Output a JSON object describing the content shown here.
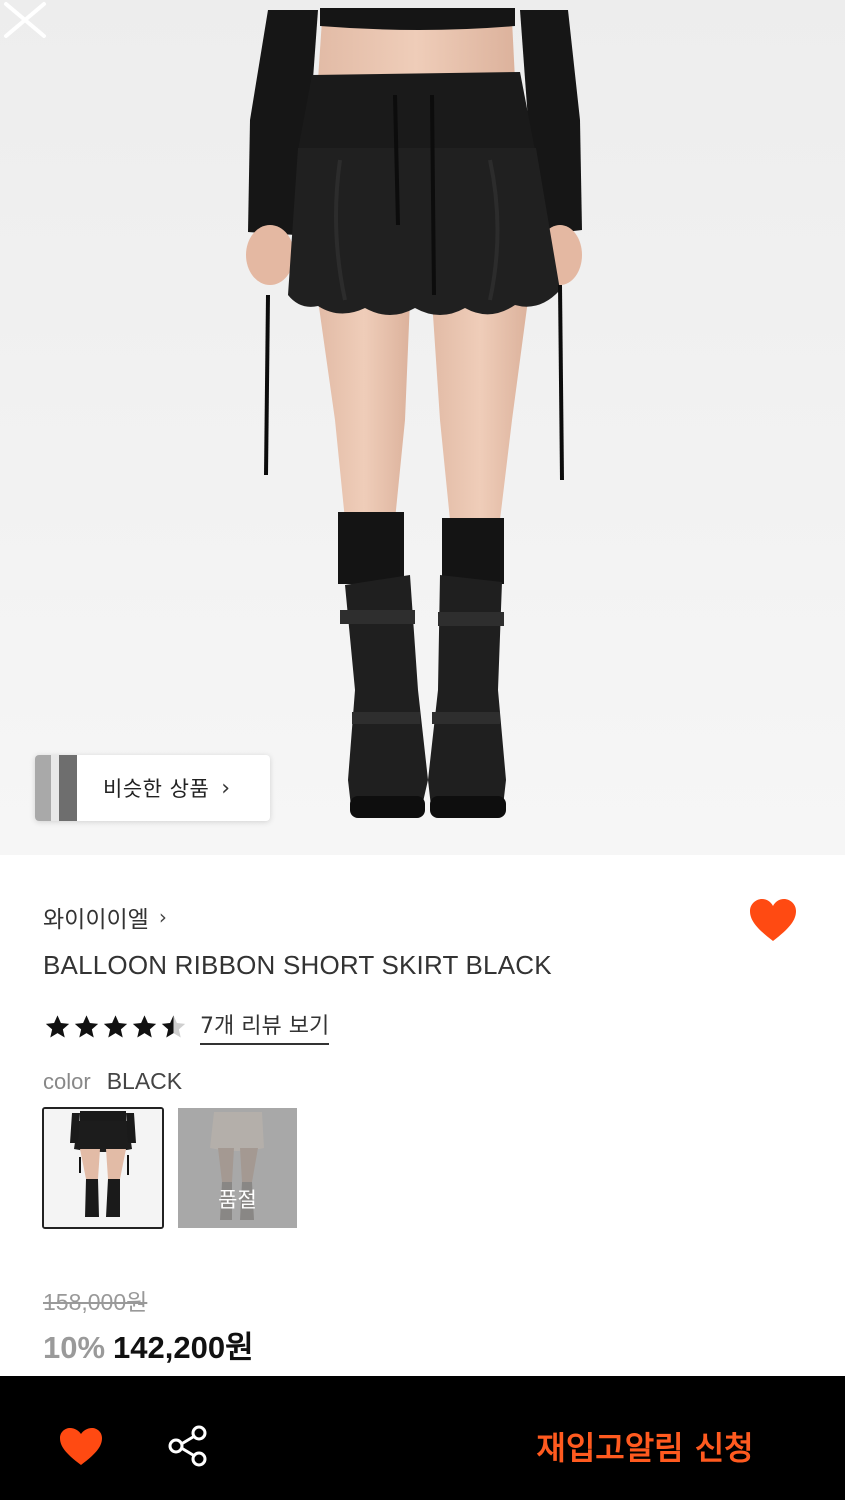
{
  "colors": {
    "accent": "#ff5a1f",
    "heart": "#ff4a12",
    "bottom_bar": "#000000"
  },
  "hero": {
    "close_icon": "close-icon",
    "similar_products": {
      "label": "비슷한 상품",
      "icon": "chevron-right-icon"
    }
  },
  "product": {
    "brand": "와이이이엘",
    "brand_icon": "chevron-right-icon",
    "title": "BALLOON RIBBON SHORT SKIRT BLACK",
    "rating": 4.5,
    "rating_max": 5,
    "review_link": "7개 리뷰 보기",
    "wishlisted": true,
    "color_label": "color",
    "color_value": "BLACK",
    "swatches": [
      {
        "name": "BLACK",
        "selected": true,
        "sold_out": false
      },
      {
        "name": "",
        "selected": false,
        "sold_out": true,
        "sold_out_label": "품절"
      }
    ],
    "original_price": "158,000원",
    "discount": "10%",
    "final_price": "142,200원"
  },
  "bottom_bar": {
    "wish_icon": "heart-icon",
    "share_icon": "share-icon",
    "restock_button": "재입고알림 신청"
  }
}
